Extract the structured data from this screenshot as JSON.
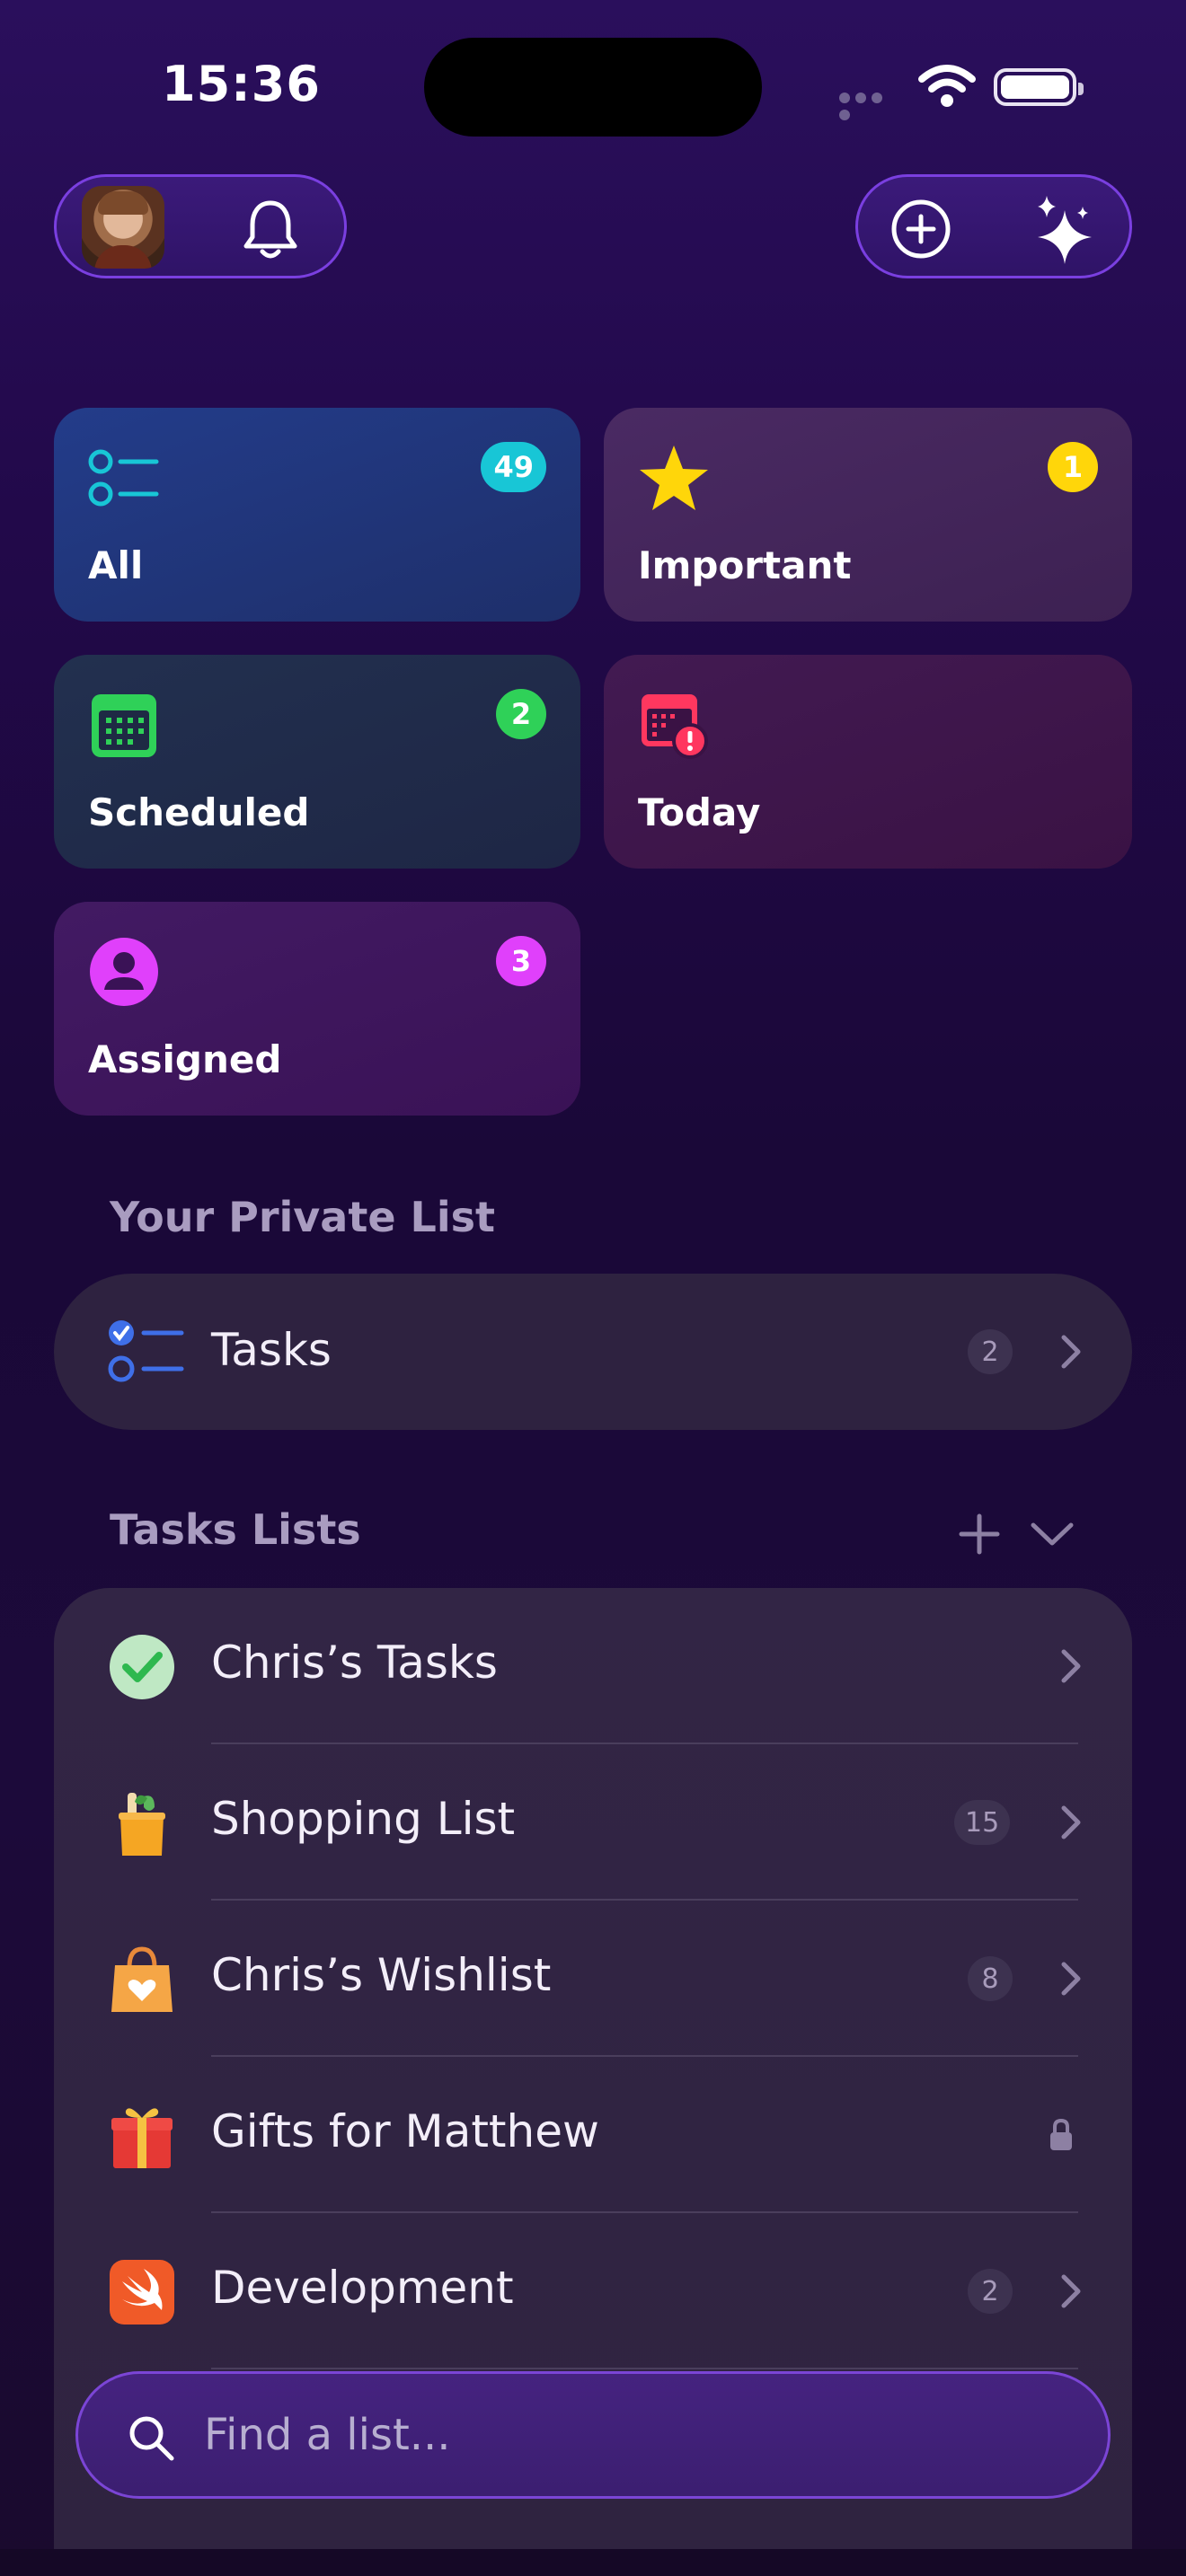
{
  "status_bar": {
    "time": "15:36"
  },
  "header": {
    "avatar_alt": "Profile photo",
    "notifications_icon": "bell-icon",
    "add_icon": "plus-circle-icon",
    "ai_icon": "sparkles-icon"
  },
  "smart_lists": {
    "all": {
      "label": "All",
      "count": "49",
      "color": "#18c6d6"
    },
    "important": {
      "label": "Important",
      "count": "1",
      "color": "#ffd60a"
    },
    "scheduled": {
      "label": "Scheduled",
      "count": "2",
      "color": "#2fd158"
    },
    "today": {
      "label": "Today",
      "color": "#ff375f"
    },
    "assigned": {
      "label": "Assigned",
      "count": "3",
      "color": "#e040fb"
    }
  },
  "private_section": {
    "title": "Your Private List",
    "item": {
      "label": "Tasks",
      "count": "2"
    }
  },
  "task_lists": {
    "title": "Tasks Lists",
    "items": [
      {
        "label": "Chris’s Tasks",
        "count": ""
      },
      {
        "label": "Shopping List",
        "count": "15"
      },
      {
        "label": "Chris’s Wishlist",
        "count": "8"
      },
      {
        "label": "Gifts for Matthew",
        "count": ""
      },
      {
        "label": "Development",
        "count": "2"
      }
    ]
  },
  "search": {
    "placeholder": "Find a list..."
  }
}
